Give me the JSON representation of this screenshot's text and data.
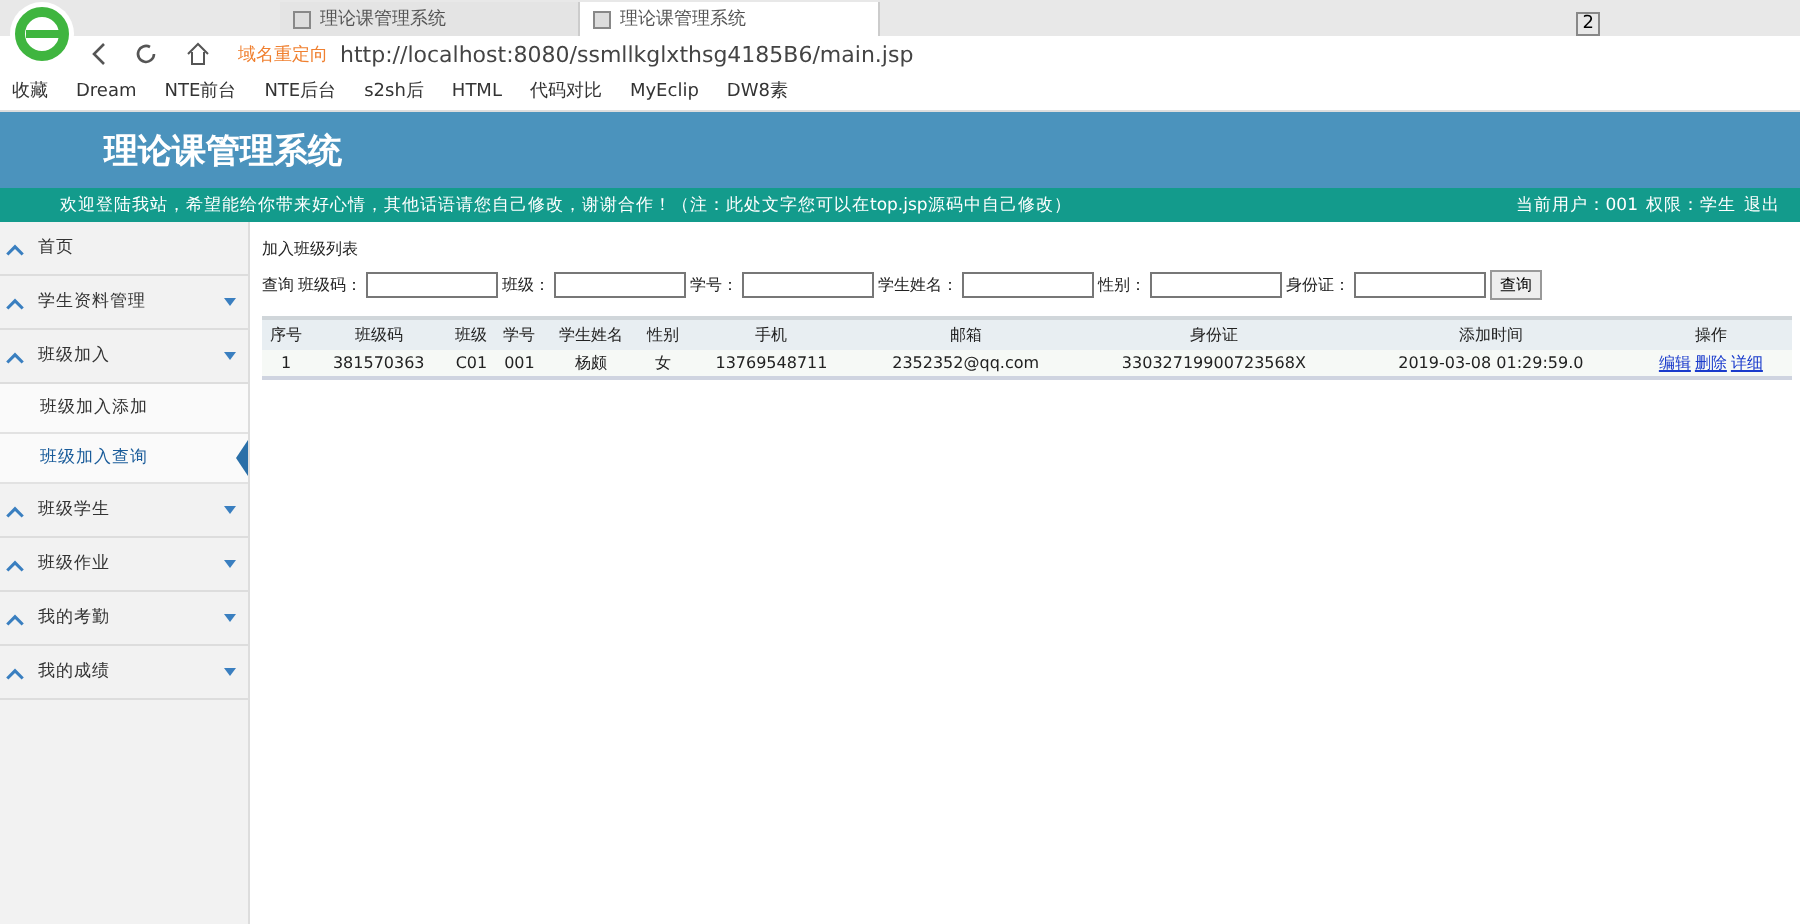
{
  "browser": {
    "tabs": [
      {
        "title": "理论课管理系统",
        "selected": false
      },
      {
        "title": "理论课管理系统",
        "selected": true
      }
    ],
    "tab_count": "2",
    "redirect_label": "域名重定向",
    "url": "http://localhost:8080/ssmllkglxthsg4185B6/main.jsp",
    "bookmarks": [
      {
        "label": "收藏"
      },
      {
        "label": "Dream"
      },
      {
        "label": "NTE前台"
      },
      {
        "label": "NTE后台"
      },
      {
        "label": "s2sh后"
      },
      {
        "label": "HTML"
      },
      {
        "label": "代码对比"
      },
      {
        "label": "MyEclip"
      },
      {
        "label": "DW8素"
      }
    ]
  },
  "header": {
    "title": "理论课管理系统",
    "welcome": "欢迎登陆我站，希望能给你带来好心情，其他话语请您自己修改，谢谢合作！（注：此处文字您可以在top.jsp源码中自己修改）",
    "user": "当前用户：001",
    "role": "权限：学生",
    "logout": "退出"
  },
  "sidebar": {
    "items": [
      {
        "label": "首页"
      },
      {
        "label": "学生资料管理"
      },
      {
        "label": "班级加入",
        "children": [
          {
            "label": "班级加入添加",
            "selected": false
          },
          {
            "label": "班级加入查询",
            "selected": true
          }
        ]
      },
      {
        "label": "班级学生"
      },
      {
        "label": "班级作业"
      },
      {
        "label": "我的考勤"
      },
      {
        "label": "我的成绩"
      }
    ]
  },
  "content": {
    "title": "加入班级列表",
    "search": {
      "label": "查询",
      "fields": [
        {
          "label": "班级码："
        },
        {
          "label": "班级："
        },
        {
          "label": "学号："
        },
        {
          "label": "学生姓名："
        },
        {
          "label": "性别："
        },
        {
          "label": "身份证："
        }
      ],
      "button": "查询"
    },
    "table": {
      "columns": [
        "序号",
        "班级码",
        "班级",
        "学号",
        "学生姓名",
        "性别",
        "手机",
        "邮箱",
        "身份证",
        "添加时间",
        "操作"
      ],
      "rows": [
        {
          "cells": [
            "1",
            "381570363",
            "C01",
            "001",
            "杨颇",
            "女",
            "13769548711",
            "2352352@qq.com",
            "33032719900723568X",
            "2019-03-08 01:29:59.0"
          ],
          "actions": [
            "编辑",
            "删除",
            "详细"
          ]
        }
      ]
    }
  }
}
